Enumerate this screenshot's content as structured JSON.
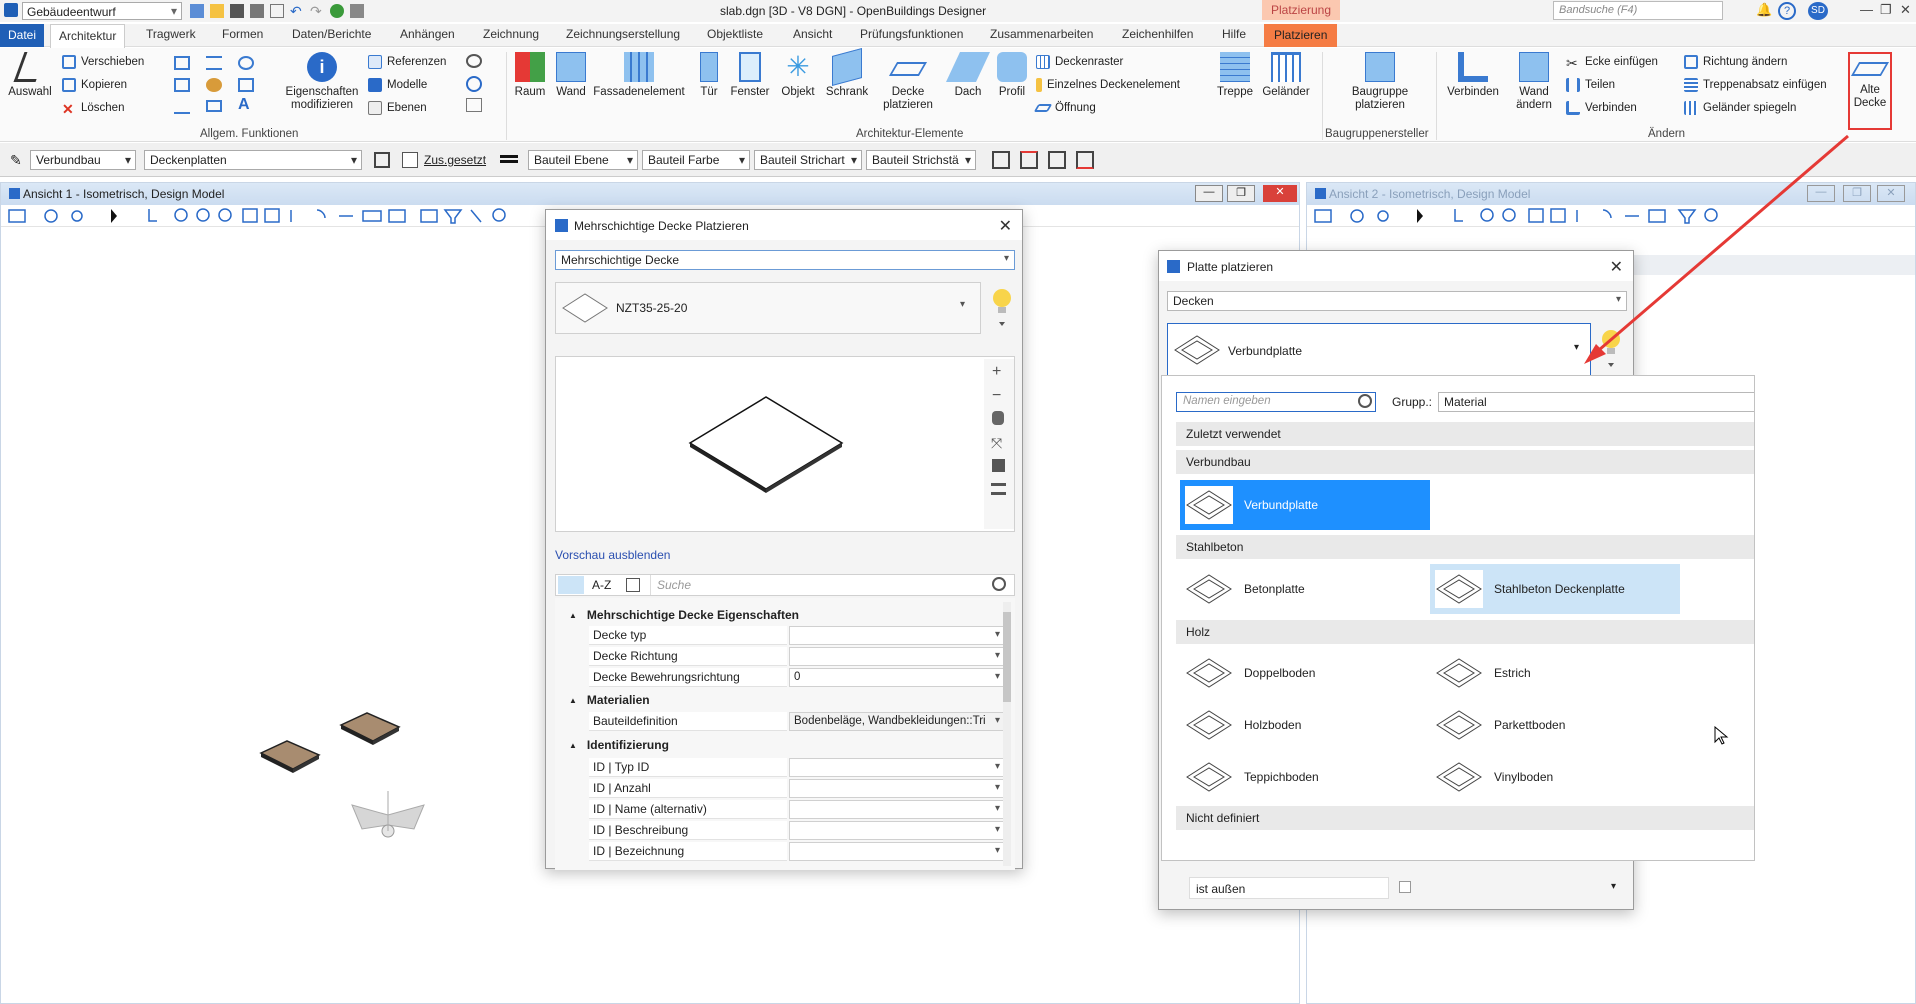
{
  "titlebar": {
    "workspace": "Gebäudeentwurf",
    "title": "slab.dgn [3D - V8 DGN] - OpenBuildings Designer",
    "context_group": "Platzierung",
    "search_placeholder": "Bandsuche (F4)",
    "user": "SD"
  },
  "tabs": [
    "Datei",
    "Architektur",
    "Tragwerk",
    "Formen",
    "Daten/Berichte",
    "Anhängen",
    "Zeichnung",
    "Zeichnungserstellung",
    "Objektliste",
    "Ansicht",
    "Prüfungsfunktionen",
    "Zusammenarbeiten",
    "Zeichenhilfen",
    "Hilfe",
    "Platzieren"
  ],
  "ribbon": {
    "auswahl": "Auswahl",
    "verschieben": "Verschieben",
    "kopieren": "Kopieren",
    "loeschen": "Löschen",
    "eigenschaften": "Eigenschaften modifizieren",
    "referenzen": "Referenzen",
    "modelle": "Modelle",
    "ebenen": "Ebenen",
    "group_allgem": "Allgem. Funktionen",
    "raum": "Raum",
    "wand": "Wand",
    "fassade": "Fassadenelement",
    "tuer": "Tür",
    "fenster": "Fenster",
    "objekt": "Objekt",
    "schrank": "Schrank",
    "decke": "Decke platzieren",
    "dach": "Dach",
    "profil": "Profil",
    "deckenraster": "Deckenraster",
    "einzelnes": "Einzelnes Deckenelement",
    "oeffnung": "Öffnung",
    "treppe": "Treppe",
    "gelaender": "Geländer",
    "group_arch": "Architektur-Elemente",
    "baugruppe": "Baugruppe platzieren",
    "group_baugruppe": "Baugruppenersteller",
    "verbinden_big": "Verbinden",
    "wand_aendern": "Wand ändern",
    "ecke": "Ecke einfügen",
    "teilen": "Teilen",
    "verbinden": "Verbinden",
    "richtung": "Richtung ändern",
    "treppenabsatz": "Treppenabsatz einfügen",
    "gelaender_spiegeln": "Geländer spiegeln",
    "alte_decke": "Alte Decke",
    "group_aendern": "Ändern"
  },
  "attrbar": {
    "category": "Verbundbau",
    "family": "Deckenplatten",
    "zus": "Zus.gesetzt",
    "ebene": "Bauteil Ebene",
    "farbe": "Bauteil Farbe",
    "strichart": "Bauteil Strichart",
    "strichstaerke": "Bauteil Strichstä"
  },
  "view1": {
    "title": "Ansicht 1 - Isometrisch, Design Model"
  },
  "view2": {
    "title": "Ansicht 2 - Isometrisch, Design Model"
  },
  "dlg1": {
    "title": "Mehrschichtige Decke Platzieren",
    "type": "Mehrschichtige Decke",
    "style": "NZT35-25-20",
    "preview_link": "Vorschau ausblenden",
    "search_placeholder": "Suche",
    "az": "A-Z",
    "sections": [
      {
        "name": "Mehrschichtige Decke Eigenschaften",
        "rows": [
          {
            "label": "Decke typ",
            "value": ""
          },
          {
            "label": "Decke Richtung",
            "value": ""
          },
          {
            "label": "Decke Bewehrungsrichtung",
            "value": "0"
          }
        ]
      },
      {
        "name": "Materialien",
        "rows": [
          {
            "label": "Bauteildefinition",
            "value": "Bodenbeläge, Wandbekleidungen::Tri"
          }
        ]
      },
      {
        "name": "Identifizierung",
        "rows": [
          {
            "label": "ID | Typ ID",
            "value": ""
          },
          {
            "label": "ID | Anzahl",
            "value": ""
          },
          {
            "label": "ID | Name (alternativ)",
            "value": ""
          },
          {
            "label": "ID | Beschreibung",
            "value": ""
          },
          {
            "label": "ID | Bezeichnung",
            "value": ""
          }
        ]
      }
    ]
  },
  "dlg2": {
    "title": "Platte platzieren",
    "type": "Decken",
    "selected": "Verbundplatte",
    "name_placeholder": "Namen eingeben",
    "group_label": "Grupp.:",
    "group_value": "Material",
    "categories": [
      {
        "name": "Zuletzt verwendet",
        "items": []
      },
      {
        "name": "Verbundbau",
        "items": [
          "Verbundplatte"
        ]
      },
      {
        "name": "Stahlbeton",
        "items": [
          "Betonplatte",
          "Stahlbeton Deckenplatte"
        ]
      },
      {
        "name": "Holz",
        "items": [
          "Doppelboden",
          "Estrich",
          "Holzboden",
          "Parkettboden",
          "Teppichboden",
          "Vinylboden"
        ]
      },
      {
        "name": "Nicht definiert",
        "items": []
      }
    ],
    "footer_label": "ist außen"
  },
  "colors": {
    "accent": "#1f5fb6",
    "selected": "#1e90ff",
    "hover": "#cce4f7",
    "arrow": "#e53935",
    "platzieren": "#f57c44"
  }
}
